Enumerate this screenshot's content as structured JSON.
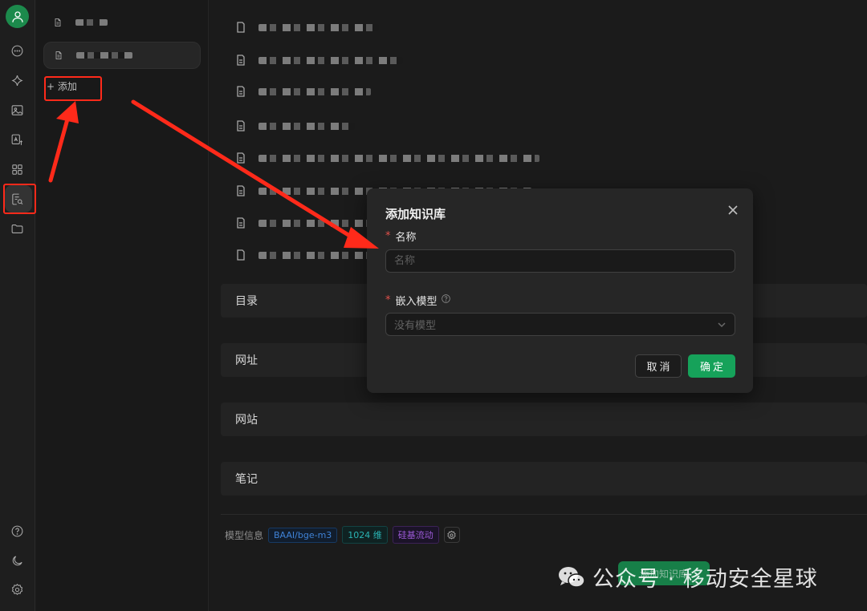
{
  "sidebar": {
    "add_label": "+ 添加"
  },
  "sections": [
    {
      "label": "目录"
    },
    {
      "label": "网址"
    },
    {
      "label": "网站"
    },
    {
      "label": "笔记"
    }
  ],
  "footer": {
    "model_info_label": "模型信息",
    "tags": [
      "BAAI/bge-m3",
      "1024 维",
      "硅基流动"
    ]
  },
  "modal": {
    "title": "添加知识库",
    "name_label": "名称",
    "name_placeholder": "名称",
    "model_label": "嵌入模型",
    "model_placeholder": "没有模型",
    "cancel": "取消",
    "confirm": "确定"
  },
  "watermark": {
    "button_text": "添加知识库",
    "text": "公众号 · 移动安全星球"
  },
  "colors": {
    "accent": "#16a25a",
    "highlight": "#ff2a1a"
  }
}
